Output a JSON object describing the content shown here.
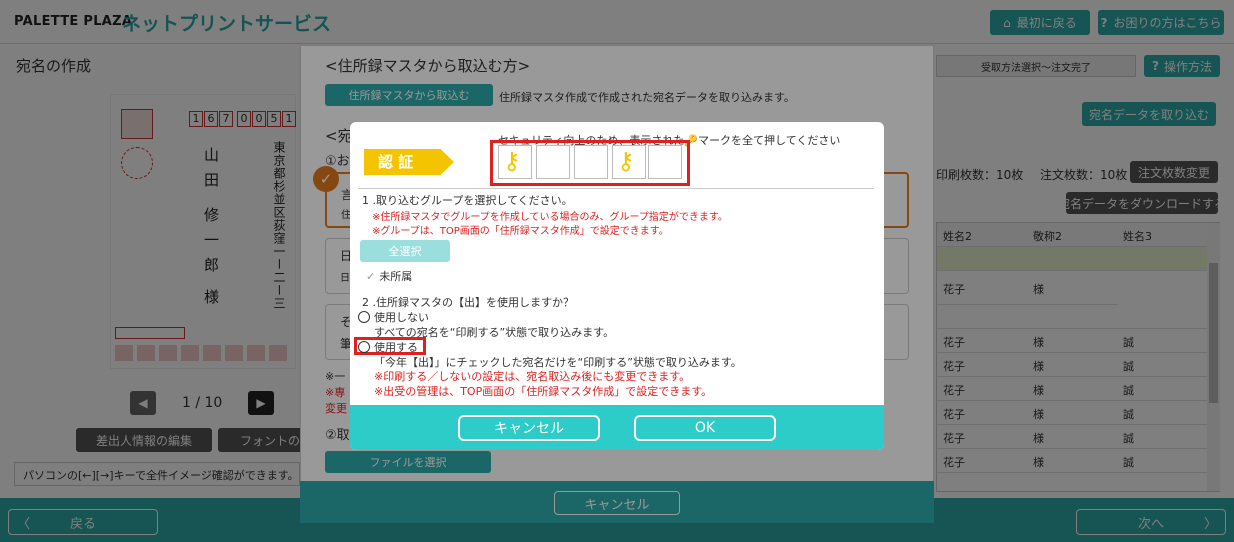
{
  "header": {
    "logo": "PALETTE PLAZA",
    "service_title": "ネットプリントサービス",
    "back_to_top": "最初に戻る",
    "help": "お困りの方はこちら"
  },
  "page": {
    "title": "宛名の作成",
    "step_label": "受取方法選択〜注文完了",
    "operation_button": "操作方法",
    "import_data_button": "宛名データを取り込む",
    "print_count": "印刷枚数：10枚",
    "order_count": "注文枚数：10枚",
    "order_change_button": "注文枚数変更",
    "download_button": "宛名データをダウンロードする",
    "pager": "1 / 10",
    "sender_edit_button": "差出人情報の編集",
    "font_button": "フォントの選択",
    "hint": "パソコンの[←][→]キーで全件イメージ確認ができます。",
    "back_button": "戻る",
    "next_button": "次へ"
  },
  "postcard": {
    "zip_digits": [
      "1",
      "6",
      "7",
      "0",
      "0",
      "5",
      "1"
    ],
    "name_lines": [
      "山田",
      "修一郎",
      "様"
    ],
    "address": "東京都杉並区荻窪一ー二ー三"
  },
  "table": {
    "headers": [
      "姓名2",
      "敬称2",
      "姓名3"
    ],
    "rows": [
      [
        "",
        "",
        ""
      ],
      [
        "花子",
        "様",
        ""
      ],
      [
        "",
        "",
        ""
      ],
      [
        "花子",
        "様",
        "誠"
      ],
      [
        "花子",
        "様",
        "誠"
      ],
      [
        "花子",
        "様",
        "誠"
      ],
      [
        "花子",
        "様",
        "誠"
      ],
      [
        "花子",
        "様",
        "誠"
      ],
      [
        "花子",
        "様",
        "誠"
      ]
    ]
  },
  "import_dialog": {
    "heading": "<住所録マスタから取込む方>",
    "button": "住所録マスタから取込む",
    "desc": "住所録マスタ作成で作成された宛名データを取り込みます。",
    "heading2_partial": "<宛",
    "step1_partial": "①お",
    "partial_a": "言",
    "partial_b": "住",
    "partial_c": "日",
    "partial_d": "日",
    "partial_e": "そ",
    "partial_f": "筆",
    "partial_g": "※一",
    "partial_h": "※専",
    "partial_i": "変更",
    "step2_partial": "②取",
    "file_button": "ファイルを選択",
    "cancel": "キャンセル"
  },
  "auth_modal": {
    "badge": "認 証",
    "instruction": "セキュリティ向上のため、表示された🔑マークを全て押してください",
    "q1": "1 .取り込むグループを選択してください。",
    "q1_note1": "※住所録マスタでグループを作成している場合のみ、グループ指定ができます。",
    "q1_note2": "※グループは、TOP画面の「住所録マスタ作成」で設定できます。",
    "select_all": "全選択",
    "unassigned": "未所属",
    "q2": "2 .住所録マスタの【出】を使用しますか？",
    "opt_no": "使用しない",
    "opt_no_desc": "すべての宛名を“印刷する”状態で取り込みます。",
    "opt_yes": "使用する",
    "opt_yes_desc": "「今年【出】」にチェックした宛名だけを“印刷する”状態で取り込みます。",
    "note3": "※印刷する／しないの設定は、宛名取込み後にも変更できます。",
    "note4": "※出受の管理は、TOP画面の「住所録マスタ作成」で設定できます。",
    "cancel": "キャンセル",
    "ok": "OK",
    "keys": [
      true,
      false,
      false,
      true,
      false
    ]
  },
  "colors": {
    "teal": "#2eaaaa",
    "badge_yellow": "#f5c400",
    "red_highlight": "#e02020"
  }
}
